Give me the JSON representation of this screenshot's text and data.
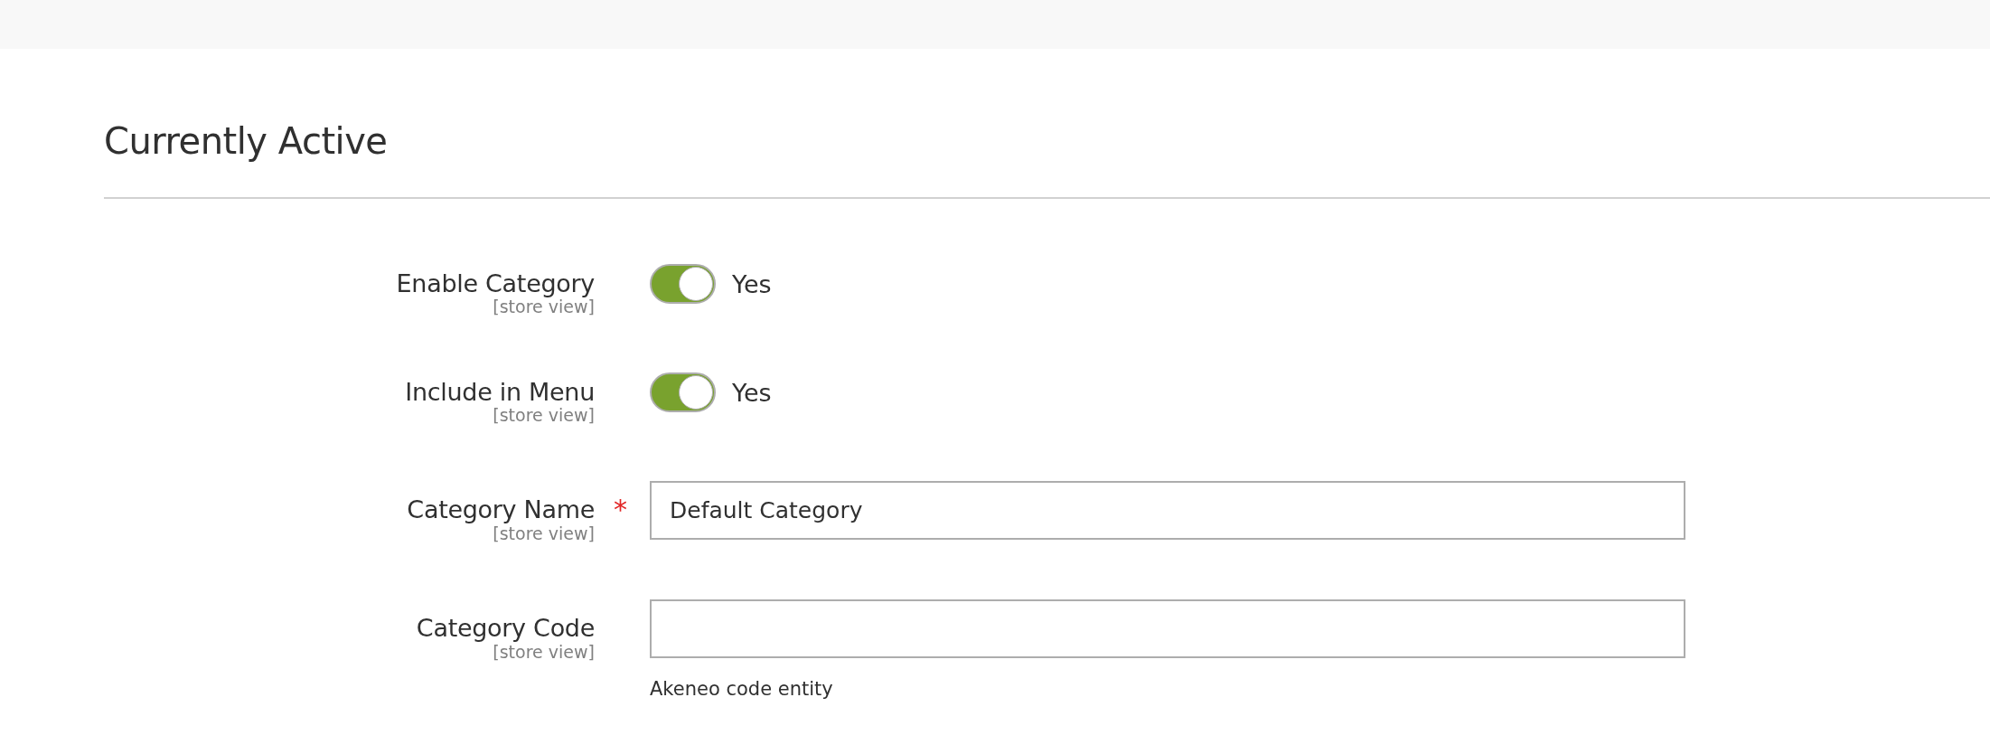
{
  "section": {
    "title": "Currently Active"
  },
  "fields": [
    {
      "kind": "toggle",
      "label": "Enable Category",
      "scope": "[store view]",
      "on": true,
      "value": "Yes"
    },
    {
      "kind": "toggle",
      "label": "Include in Menu",
      "scope": "[store view]",
      "on": true,
      "value": "Yes"
    },
    {
      "kind": "text",
      "label": "Category Name",
      "scope": "[store view]",
      "required_mark": "*",
      "value": "Default Category"
    },
    {
      "kind": "text",
      "label": "Category Code",
      "scope": "[store view]",
      "note": "Akeneo code entity"
    }
  ]
}
